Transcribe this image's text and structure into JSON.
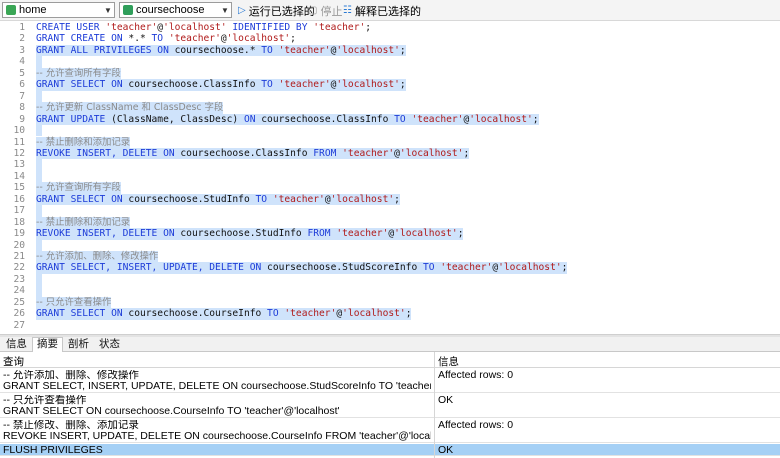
{
  "toolbar": {
    "connection_value": "home",
    "database_value": "coursechoose",
    "run_selected_label": "运行已选择的",
    "stop_label": "停止",
    "explain_selected_label": "解释已选择的",
    "colors": {
      "connection_icon": "#3aa655",
      "database_icon": "#2f9e5a",
      "run_icon": "#2a7ad4"
    }
  },
  "editor": {
    "lines": [
      {
        "num": "1",
        "selected": false,
        "tokens": [
          [
            "kw",
            "CREATE USER "
          ],
          [
            "str",
            "'teacher'"
          ],
          [
            "plain",
            "@"
          ],
          [
            "str",
            "'localhost'"
          ],
          [
            "kw",
            " IDENTIFIED BY "
          ],
          [
            "str",
            "'teacher'"
          ],
          [
            "plain",
            ";"
          ]
        ]
      },
      {
        "num": "2",
        "selected": false,
        "tokens": [
          [
            "kw",
            "GRANT CREATE ON "
          ],
          [
            "plain",
            "*.* "
          ],
          [
            "kw",
            "TO "
          ],
          [
            "str",
            "'teacher'"
          ],
          [
            "plain",
            "@"
          ],
          [
            "str",
            "'localhost'"
          ],
          [
            "plain",
            ";"
          ]
        ]
      },
      {
        "num": "3",
        "selected": true,
        "tokens": [
          [
            "kw",
            "GRANT ALL PRIVILEGES ON "
          ],
          [
            "plain",
            "coursechoose.* "
          ],
          [
            "kw",
            "TO "
          ],
          [
            "str",
            "'teacher'"
          ],
          [
            "plain",
            "@"
          ],
          [
            "str",
            "'localhost'"
          ],
          [
            "plain",
            ";"
          ]
        ]
      },
      {
        "num": "4",
        "selected": true,
        "tokens": []
      },
      {
        "num": "5",
        "selected": true,
        "tokens": [
          [
            "cmt",
            "-- 允许查询所有字段"
          ]
        ]
      },
      {
        "num": "6",
        "selected": true,
        "tokens": [
          [
            "kw",
            "GRANT SELECT ON "
          ],
          [
            "plain",
            "coursechoose.ClassInfo "
          ],
          [
            "kw",
            "TO "
          ],
          [
            "str",
            "'teacher'"
          ],
          [
            "plain",
            "@"
          ],
          [
            "str",
            "'localhost'"
          ],
          [
            "plain",
            ";"
          ]
        ]
      },
      {
        "num": "7",
        "selected": true,
        "tokens": []
      },
      {
        "num": "8",
        "selected": true,
        "tokens": [
          [
            "cmt",
            "-- 允许更新 ClassName 和 ClassDesc 字段"
          ]
        ]
      },
      {
        "num": "9",
        "selected": true,
        "tokens": [
          [
            "kw",
            "GRANT UPDATE "
          ],
          [
            "plain",
            "(ClassName, ClassDesc) "
          ],
          [
            "kw",
            "ON "
          ],
          [
            "plain",
            "coursechoose.ClassInfo "
          ],
          [
            "kw",
            "TO "
          ],
          [
            "str",
            "'teacher'"
          ],
          [
            "plain",
            "@"
          ],
          [
            "str",
            "'localhost'"
          ],
          [
            "plain",
            ";"
          ]
        ]
      },
      {
        "num": "10",
        "selected": true,
        "tokens": []
      },
      {
        "num": "11",
        "selected": true,
        "tokens": [
          [
            "cmt",
            "-- 禁止删除和添加记录"
          ]
        ]
      },
      {
        "num": "12",
        "selected": true,
        "tokens": [
          [
            "kw",
            "REVOKE INSERT, DELETE ON "
          ],
          [
            "plain",
            "coursechoose.ClassInfo "
          ],
          [
            "kw",
            "FROM "
          ],
          [
            "str",
            "'teacher'"
          ],
          [
            "plain",
            "@"
          ],
          [
            "str",
            "'localhost'"
          ],
          [
            "plain",
            ";"
          ]
        ]
      },
      {
        "num": "13",
        "selected": true,
        "tokens": []
      },
      {
        "num": "14",
        "selected": true,
        "tokens": []
      },
      {
        "num": "15",
        "selected": true,
        "tokens": [
          [
            "cmt",
            "-- 允许查询所有字段"
          ]
        ]
      },
      {
        "num": "16",
        "selected": true,
        "tokens": [
          [
            "kw",
            "GRANT SELECT ON "
          ],
          [
            "plain",
            "coursechoose.StudInfo "
          ],
          [
            "kw",
            "TO "
          ],
          [
            "str",
            "'teacher'"
          ],
          [
            "plain",
            "@"
          ],
          [
            "str",
            "'localhost'"
          ],
          [
            "plain",
            ";"
          ]
        ]
      },
      {
        "num": "17",
        "selected": true,
        "tokens": []
      },
      {
        "num": "18",
        "selected": true,
        "tokens": [
          [
            "cmt",
            "-- 禁止删除和添加记录"
          ]
        ]
      },
      {
        "num": "19",
        "selected": true,
        "tokens": [
          [
            "kw",
            "REVOKE INSERT, DELETE ON "
          ],
          [
            "plain",
            "coursechoose.StudInfo "
          ],
          [
            "kw",
            "FROM "
          ],
          [
            "str",
            "'teacher'"
          ],
          [
            "plain",
            "@"
          ],
          [
            "str",
            "'localhost'"
          ],
          [
            "plain",
            ";"
          ]
        ]
      },
      {
        "num": "20",
        "selected": true,
        "tokens": []
      },
      {
        "num": "21",
        "selected": true,
        "tokens": [
          [
            "cmt",
            "-- 允许添加、删除、修改操作"
          ]
        ]
      },
      {
        "num": "22",
        "selected": true,
        "tokens": [
          [
            "kw",
            "GRANT SELECT, INSERT, UPDATE, DELETE ON "
          ],
          [
            "plain",
            "coursechoose.StudScoreInfo "
          ],
          [
            "kw",
            "TO "
          ],
          [
            "str",
            "'teacher'"
          ],
          [
            "plain",
            "@"
          ],
          [
            "str",
            "'localhost'"
          ],
          [
            "plain",
            ";"
          ]
        ]
      },
      {
        "num": "23",
        "selected": true,
        "tokens": []
      },
      {
        "num": "24",
        "selected": true,
        "tokens": []
      },
      {
        "num": "25",
        "selected": true,
        "tokens": [
          [
            "cmt",
            "-- 只允许查看操作"
          ]
        ]
      },
      {
        "num": "26",
        "selected": true,
        "tokens": [
          [
            "kw",
            "GRANT SELECT ON "
          ],
          [
            "plain",
            "coursechoose.CourseInfo "
          ],
          [
            "kw",
            "TO "
          ],
          [
            "str",
            "'teacher'"
          ],
          [
            "plain",
            "@"
          ],
          [
            "str",
            "'localhost'"
          ],
          [
            "plain",
            ";"
          ]
        ]
      },
      {
        "num": "27",
        "selected": true,
        "tokens": []
      }
    ]
  },
  "tabs": [
    {
      "label": "信息",
      "active": false
    },
    {
      "label": "摘要",
      "active": true
    },
    {
      "label": "剖析",
      "active": false
    },
    {
      "label": "状态",
      "active": false
    }
  ],
  "results": {
    "col_query": "查询",
    "col_info": "信息",
    "rows": [
      {
        "query_lines": [
          "-- 允许添加、删除、修改操作",
          "GRANT SELECT, INSERT, UPDATE, DELETE ON coursechoose.StudScoreInfo TO 'teacher'@'localhost'"
        ],
        "info": "Affected rows: 0",
        "selected": false
      },
      {
        "query_lines": [
          "-- 只允许查看操作",
          "GRANT SELECT ON coursechoose.CourseInfo TO 'teacher'@'localhost'"
        ],
        "info": "OK",
        "selected": false
      },
      {
        "query_lines": [
          "-- 禁止修改、删除、添加记录",
          "REVOKE INSERT, UPDATE, DELETE ON coursechoose.CourseInfo FROM 'teacher'@'localhost'"
        ],
        "info": "Affected rows: 0",
        "selected": false
      },
      {
        "query_lines": [
          "FLUSH PRIVILEGES"
        ],
        "info": "OK",
        "selected": true
      }
    ]
  }
}
